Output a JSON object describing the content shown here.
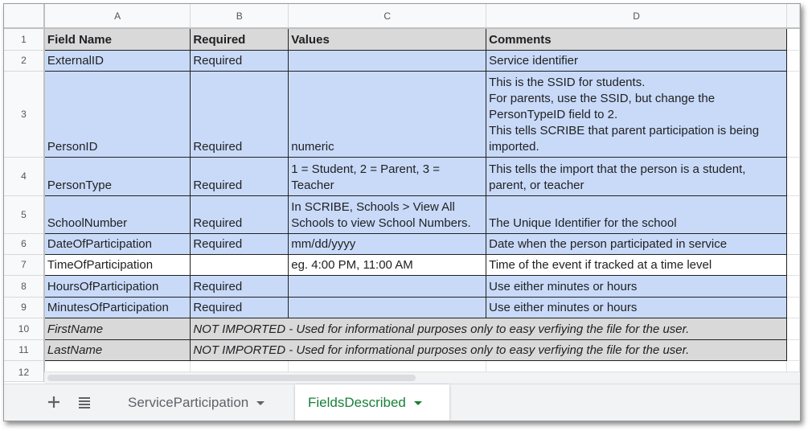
{
  "columns": [
    "A",
    "B",
    "C",
    "D"
  ],
  "rows": [
    {
      "num": "1",
      "cells": [
        "Field Name",
        "Required",
        "Values",
        "Comments"
      ]
    },
    {
      "num": "2",
      "cells": [
        "ExternalID",
        "Required",
        "",
        "Service identifier"
      ]
    },
    {
      "num": "3",
      "cells": [
        "PersonID",
        "Required",
        "numeric",
        "This is the SSID for students.\nFor parents, use the SSID, but change the PersonTypeID field to 2.\nThis tells SCRIBE that parent participation is being imported."
      ]
    },
    {
      "num": "4",
      "cells": [
        "PersonType",
        "Required",
        "1 = Student, 2 = Parent, 3 = Teacher",
        "This tells the import that the person is a student, parent, or teacher"
      ]
    },
    {
      "num": "5",
      "cells": [
        "SchoolNumber",
        "Required",
        "In SCRIBE, Schools > View All Schools to view School Numbers.",
        "The Unique Identifier for the school"
      ]
    },
    {
      "num": "6",
      "cells": [
        "DateOfParticipation",
        "Required",
        "mm/dd/yyyy",
        "Date when the person participated in service"
      ]
    },
    {
      "num": "7",
      "cells": [
        "TimeOfParticipation",
        "",
        "eg. 4:00 PM, 11:00 AM",
        "Time of the event if tracked at a time level"
      ]
    },
    {
      "num": "8",
      "cells": [
        "HoursOfParticipation",
        "Required",
        "",
        "Use either minutes or hours"
      ]
    },
    {
      "num": "9",
      "cells": [
        "MinutesOfParticipation",
        "Required",
        "",
        "Use either minutes or hours"
      ]
    },
    {
      "num": "10",
      "cells": [
        "FirstName",
        "NOT IMPORTED - Used for informational purposes only to easy verfiying the file for the user."
      ]
    },
    {
      "num": "11",
      "cells": [
        "LastName",
        "NOT IMPORTED - Used for informational purposes only to easy verfiying the file for the user."
      ]
    },
    {
      "num": "12",
      "cells": []
    }
  ],
  "tabs": [
    {
      "label": "ServiceParticipation",
      "active": false
    },
    {
      "label": "FieldsDescribed",
      "active": true
    }
  ],
  "icons": {
    "add": "plus-icon",
    "all_sheets": "list-icon"
  },
  "colors": {
    "header_fill": "#d9d9d9",
    "cell_fill": "#c9daf8",
    "active_tab": "#188038"
  }
}
